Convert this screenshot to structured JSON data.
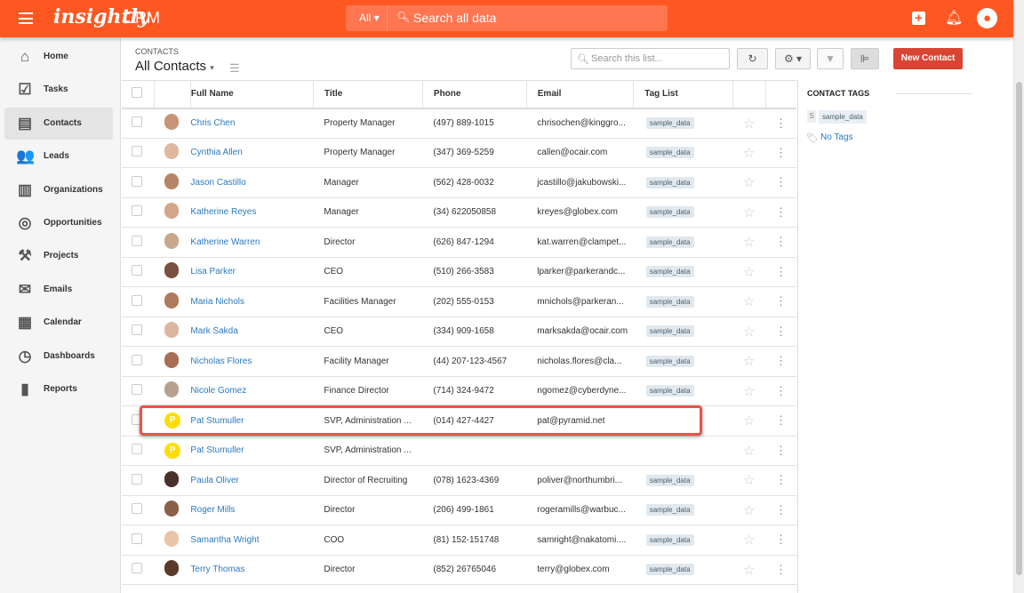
{
  "topbar": {
    "logo": "insightly",
    "product": "CRM",
    "search_scope": "All",
    "search_placeholder": "Search all data"
  },
  "sidebar": {
    "items": [
      {
        "label": "Home",
        "icon": "home-icon",
        "glyph": "⌂"
      },
      {
        "label": "Tasks",
        "icon": "tasks-icon",
        "glyph": "☑"
      },
      {
        "label": "Contacts",
        "icon": "contacts-icon",
        "glyph": "▤",
        "active": true
      },
      {
        "label": "Leads",
        "icon": "leads-icon",
        "glyph": "👥"
      },
      {
        "label": "Organizations",
        "icon": "organizations-icon",
        "glyph": "▥"
      },
      {
        "label": "Opportunities",
        "icon": "opportunities-icon",
        "glyph": "◎"
      },
      {
        "label": "Projects",
        "icon": "projects-icon",
        "glyph": "⚒"
      },
      {
        "label": "Emails",
        "icon": "emails-icon",
        "glyph": "✉"
      },
      {
        "label": "Calendar",
        "icon": "calendar-icon",
        "glyph": "▦"
      },
      {
        "label": "Dashboards",
        "icon": "dashboards-icon",
        "glyph": "◷"
      },
      {
        "label": "Reports",
        "icon": "reports-icon",
        "glyph": "▮"
      }
    ]
  },
  "main": {
    "breadcrumb": "CONTACTS",
    "view": "All Contacts",
    "list_search_placeholder": "Search this list...",
    "new_button": "New Contact",
    "columns": [
      "Full Name",
      "Title",
      "Phone",
      "Email",
      "Tag List"
    ],
    "rows": [
      {
        "name": "Chris Chen",
        "title": "Property Manager",
        "phone": "(497) 889-1015",
        "email": "chrisochen@kinggro...",
        "tag": "sample_data"
      },
      {
        "name": "Cynthia Allen",
        "title": "Property Manager",
        "phone": "(347) 369-5259",
        "email": "callen@ocair.com",
        "tag": "sample_data"
      },
      {
        "name": "Jason Castillo",
        "title": "Manager",
        "phone": "(562) 428-0032",
        "email": "jcastillo@jakubowski...",
        "tag": "sample_data"
      },
      {
        "name": "Katherine Reyes",
        "title": "Manager",
        "phone": "(34) 622050858",
        "email": "kreyes@globex.com",
        "tag": "sample_data"
      },
      {
        "name": "Katherine Warren",
        "title": "Director",
        "phone": "(626) 847-1294",
        "email": "kat.warren@clampet...",
        "tag": "sample_data"
      },
      {
        "name": "Lisa Parker",
        "title": "CEO",
        "phone": "(510) 266-3583",
        "email": "lparker@parkerandc...",
        "tag": "sample_data"
      },
      {
        "name": "Maria Nichols",
        "title": "Facilities Manager",
        "phone": "(202) 555-0153",
        "email": "mnichols@parkeran...",
        "tag": "sample_data"
      },
      {
        "name": "Mark Sakda",
        "title": "CEO",
        "phone": "(334) 909-1658",
        "email": "marksakda@ocair.com",
        "tag": "sample_data"
      },
      {
        "name": "Nicholas Flores",
        "title": "Facility Manager",
        "phone": "(44) 207-123-4567",
        "email": "nicholas.flores@cla...",
        "tag": "sample_data"
      },
      {
        "name": "Nicole Gomez",
        "title": "Finance Director",
        "phone": "(714) 324-9472",
        "email": "ngomez@cyberdyne...",
        "tag": "sample_data"
      },
      {
        "name": "Pat Stumuller",
        "title": "SVP, Administration ...",
        "phone": "(014) 427-4427",
        "email": "pat@pyramid.net",
        "tag": "",
        "initial": "P"
      },
      {
        "name": "Pat Stumuller",
        "title": "SVP, Administration ...",
        "phone": "",
        "email": "",
        "tag": "",
        "initial": "P"
      },
      {
        "name": "Paula Oliver",
        "title": "Director of Recruiting",
        "phone": "(078) 1623-4369",
        "email": "poliver@northumbri...",
        "tag": "sample_data"
      },
      {
        "name": "Roger Mills",
        "title": "Director",
        "phone": "(206) 499-1861",
        "email": "rogeramills@warbuc...",
        "tag": "sample_data"
      },
      {
        "name": "Samantha Wright",
        "title": "COO",
        "phone": "(81) 152-151748",
        "email": "samright@nakatomi....",
        "tag": "sample_data"
      },
      {
        "name": "Terry Thomas",
        "title": "Director",
        "phone": "(852) 26765046",
        "email": "terry@globex.com",
        "tag": "sample_data"
      }
    ]
  },
  "rpanel": {
    "heading": "CONTACT TAGS",
    "tag_initial": "S",
    "tag": "sample_data",
    "no_tags": "No Tags"
  },
  "colors": {
    "brand": "#ff5722",
    "new_button": "#d84532",
    "link": "#2a7ac0",
    "highlight": "#e8534a"
  }
}
